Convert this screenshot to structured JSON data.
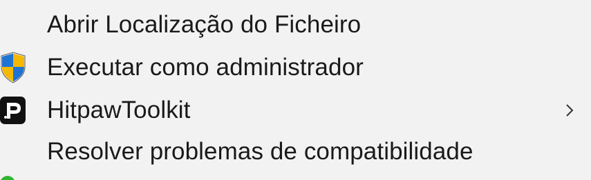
{
  "menu": {
    "items": [
      {
        "label": "Abrir Localização do Ficheiro",
        "icon": ""
      },
      {
        "label": "Executar como administrador",
        "icon": "uac-shield-icon"
      },
      {
        "label": "HitpawToolkit",
        "icon": "hitpaw-icon",
        "submenu": true
      },
      {
        "label": "Resolver problemas de compatibilidade",
        "icon": ""
      }
    ]
  },
  "colors": {
    "background": "#f2f2f2",
    "text": "#1a1a1a",
    "shield_blue": "#1f74d2",
    "shield_yellow": "#f5b800",
    "hitpaw_bg": "#111111",
    "partial_icon_green": "#2fb52f"
  }
}
